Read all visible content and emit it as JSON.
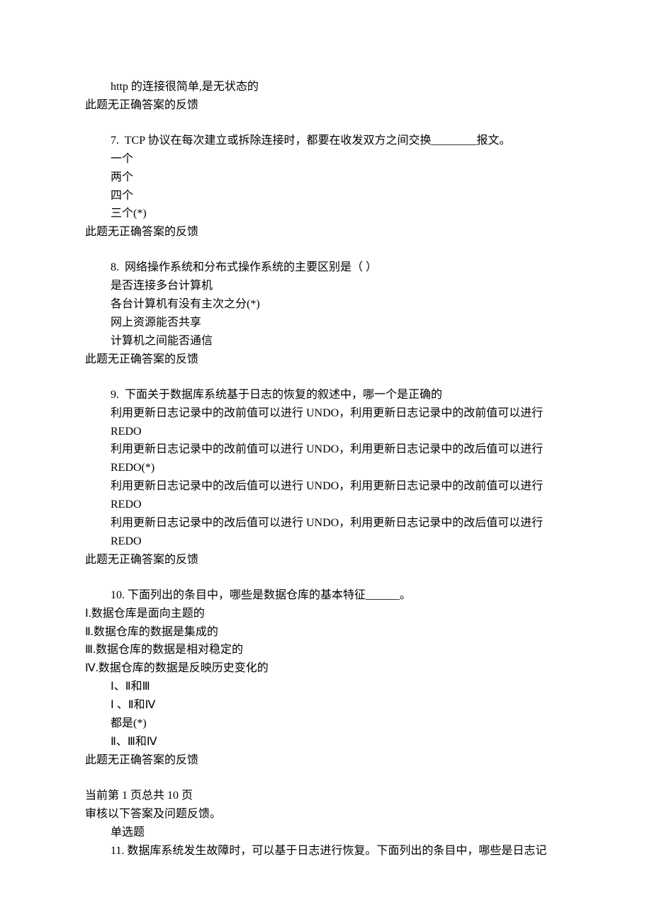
{
  "partial_tail": {
    "line": "http 的连接很简单,是无状态的",
    "feedback": "此题无正确答案的反馈"
  },
  "q7": {
    "num": "7.",
    "text_a": "TCP 协议在每次建立或拆除连接时，都要在收发双方之间交换",
    "blank": "________",
    "text_b": "报文。",
    "opts": [
      "一个",
      "两个",
      "四个",
      "三个(*)"
    ],
    "feedback": "此题无正确答案的反馈"
  },
  "q8": {
    "num": "8.",
    "text": "网络操作系统和分布式操作系统的主要区别是（ ）",
    "opts": [
      "是否连接多台计算机",
      "各台计算机有没有主次之分(*)",
      "网上资源能否共享",
      "计算机之间能否通信"
    ],
    "feedback": "此题无正确答案的反馈"
  },
  "q9": {
    "num": "9.",
    "text": "下面关于数据库系统基于日志的恢复的叙述中，哪一个是正确的",
    "opts": [
      "利用更新日志记录中的改前值可以进行 UNDO，利用更新日志记录中的改前值可以进行REDO",
      "利用更新日志记录中的改前值可以进行 UNDO，利用更新日志记录中的改后值可以进行REDO(*)",
      "利用更新日志记录中的改后值可以进行 UNDO，利用更新日志记录中的改前值可以进行REDO",
      "利用更新日志记录中的改后值可以进行 UNDO，利用更新日志记录中的改后值可以进行REDO"
    ],
    "feedback": "此题无正确答案的反馈"
  },
  "q10": {
    "num": "10.",
    "text_a": "下面列出的条目中，哪些是数据仓库的基本特征",
    "blank": "______",
    "text_b": "。",
    "stmts": [
      "Ⅰ.数据仓库是面向主题的",
      "Ⅱ.数据仓库的数据是集成的",
      "Ⅲ.数据仓库的数据是相对稳定的",
      "Ⅳ.数据仓库的数据是反映历史变化的"
    ],
    "opts": [
      "Ⅰ、Ⅱ和Ⅲ",
      "Ⅰ 、Ⅱ和Ⅳ",
      "都是(*)",
      "Ⅱ、Ⅲ和Ⅳ"
    ],
    "feedback": "此题无正确答案的反馈"
  },
  "pager": {
    "line1": "当前第 1 页总共 10 页",
    "line2": "审核以下答案及问题反馈。",
    "section": "单选题"
  },
  "q11": {
    "num": "11.",
    "text": "数据库系统发生故障时，可以基于日志进行恢复。下面列出的条目中，哪些是日志记"
  }
}
